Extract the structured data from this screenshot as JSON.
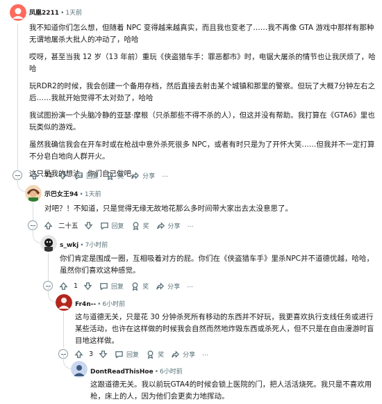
{
  "comments": [
    {
      "user": "凤凰2211",
      "time": "1天前",
      "paragraphs": [
        "我不知道你们怎么想，但随着 NPC 变得越来越真实，而且我也变老了……我不再像 GTA 游戏中那样有那种无谓地屠杀大批人的冲动了，哈哈",
        "哎呀，甚至当我 12 岁（13 年前）重玩《侠盗猎车手：罪恶都市》时，电锯大屠杀的情节也让我厌烦了，哈哈",
        "玩RDR2的时候，我会创建一个备用存档，然后直接去射击某个城镇和那里的警察。但玩了大概7分钟左右之后……我就开始觉得不太对劲了，哈哈",
        "我试图扮演一个头脑冷静的亚瑟·摩根（只杀那些不得不杀的人），但这并没有帮助。我打算在《GTA6》里也玩类似的游戏。",
        "虽然我确信我会在开车时或在枪战中意外杀死很多 NPC，或者有时只是为了开怀大笑……但我并不一定打算不分皂白地向人群开火。",
        "这只是我的想法。你们自己做吧。"
      ],
      "votes": "71",
      "reply": "回复",
      "award": "奖",
      "share": "分享",
      "more": "…"
    },
    {
      "user": "示巴女王94",
      "time": "1天前",
      "paragraphs": [
        "对吧？！不知道，只是觉得无缘无故地花那么多时间带大家出去太没意思了。"
      ],
      "votes": "二十五",
      "reply": "回复",
      "award": "奖",
      "share": "分享",
      "more": "…"
    },
    {
      "user": "s_wkj",
      "time": "7小时前",
      "paragraphs": [
        "你们肯定是围成一圈，互相吸着对方的屁。你们在《侠盗猎车手》里杀NPC并不道德优越，哈哈，虽然你们喜欢这种感觉。"
      ],
      "votes": "1",
      "reply": "回复",
      "award": "奖",
      "share": "分享",
      "more": "…"
    },
    {
      "user": "Fr4n--",
      "time": "6小时前",
      "paragraphs": [
        "这与道德无关，只是花 30 分钟杀死所有移动的东西并不好玩，我更喜欢执行支线任务或进行某些活动，也许在这样做的时候我会自然而然地炸毁东西或杀死人，但不只是在自由漫游时盲目地这样做。"
      ],
      "votes": "3",
      "reply": "回复",
      "award": "奖",
      "share": "分享",
      "more": "…"
    },
    {
      "user": "DontReadThisHoe",
      "time": "6小时前",
      "paragraphs": [
        "这跟道德无关。我以前玩GTA4的时候会锁上医院的门，把人活活烧死。我只是不喜欢用枪，床上的人，因为他们会更卖力地挥动。"
      ]
    }
  ],
  "colors": {
    "meta": "#576f76",
    "thread": "#d7dcdf",
    "text": "#1a1a1b"
  }
}
